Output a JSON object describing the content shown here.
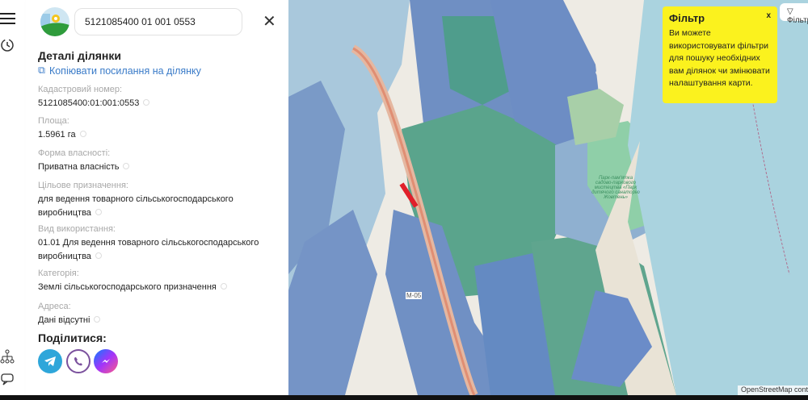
{
  "search": {
    "value": "5121085400 01 001 0553"
  },
  "panel": {
    "title": "Деталі ділянки",
    "copy_link": "Копіювати посилання на ділянку",
    "fields": [
      {
        "label": "Кадастровий номер:",
        "value": "5121085400:01:001:0553"
      },
      {
        "label": "Площа:",
        "value": "1.5961 га"
      },
      {
        "label": "Форма власності:",
        "value": "Приватна власність"
      },
      {
        "label": "Цільове призначення:",
        "value": "для ведення товарного сільськогосподарського виробництва"
      },
      {
        "label": "Вид використання:",
        "value": "01.01 Для ведення товарного сільськогосподарського виробництва"
      },
      {
        "label": "Категорія:",
        "value": "Землі сільськогосподарського призначення"
      },
      {
        "label": "Адреса:",
        "value": "Дані відсутні"
      }
    ],
    "share_title": "Поділитися:",
    "share": [
      "telegram",
      "viber",
      "messenger"
    ]
  },
  "tooltip": {
    "title": "Фільтр",
    "text": "Ви можете використовувати фільтри для пошуку необхідних вам ділянок чи змінювати налаштування карти.",
    "close": "x"
  },
  "filter_button": "Фільтр",
  "map": {
    "road_label": "М-05",
    "attribution": "OpenStreetMap contributors",
    "park_label": "Парк-пам'ятка садово-паркового мистецтва «Парк дитячого санаторію Жовтень»"
  },
  "colors": {
    "accent": "#3a7bc8",
    "tooltip": "#fbf21e",
    "selected_parcel": "#e0202a",
    "sea": "#aad3df"
  }
}
